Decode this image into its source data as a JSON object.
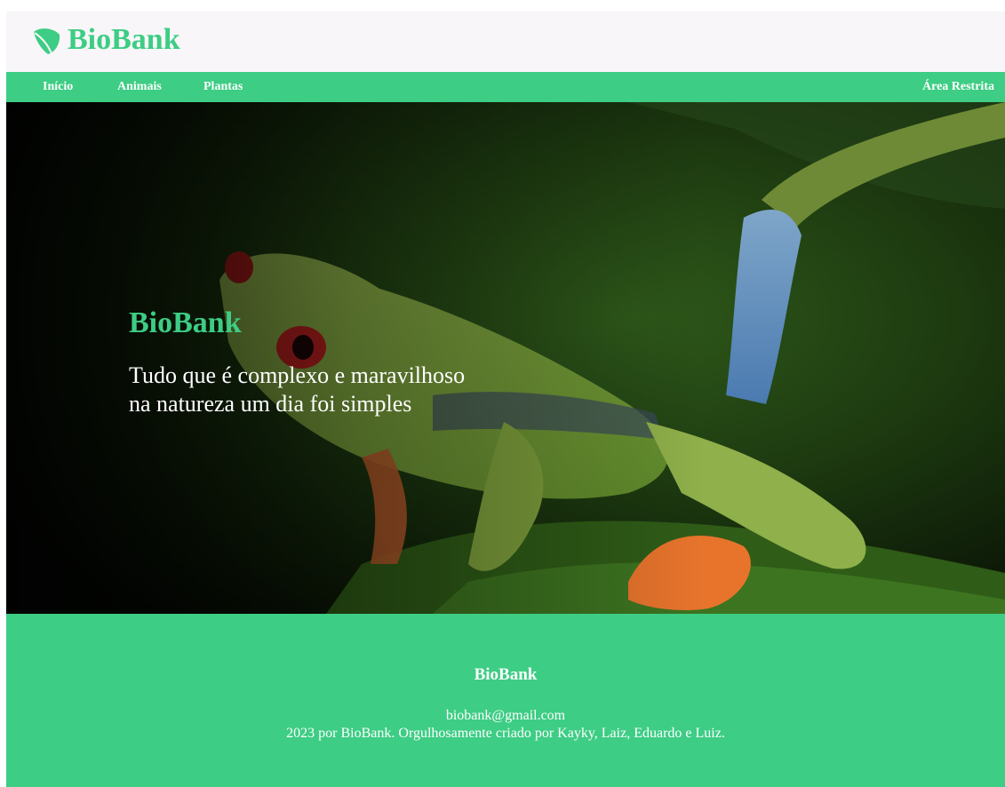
{
  "header": {
    "logo_text": "BioBank",
    "logo_icon": "leaf-icon",
    "brand_color": "#3dcd84"
  },
  "nav": {
    "items": [
      {
        "label": "Início"
      },
      {
        "label": "Animais"
      },
      {
        "label": "Plantas"
      }
    ],
    "restricted_label": "Área Restrita"
  },
  "hero": {
    "title": "BioBank",
    "tagline_line1": "Tudo que é complexo e maravilhoso",
    "tagline_line2": "na natureza um dia foi simples"
  },
  "footer": {
    "title": "BioBank",
    "email": "biobank@gmail.com",
    "credits": "2023 por BioBank. Orgulhosamente criado por Kayky, Laiz, Eduardo e Luiz."
  }
}
